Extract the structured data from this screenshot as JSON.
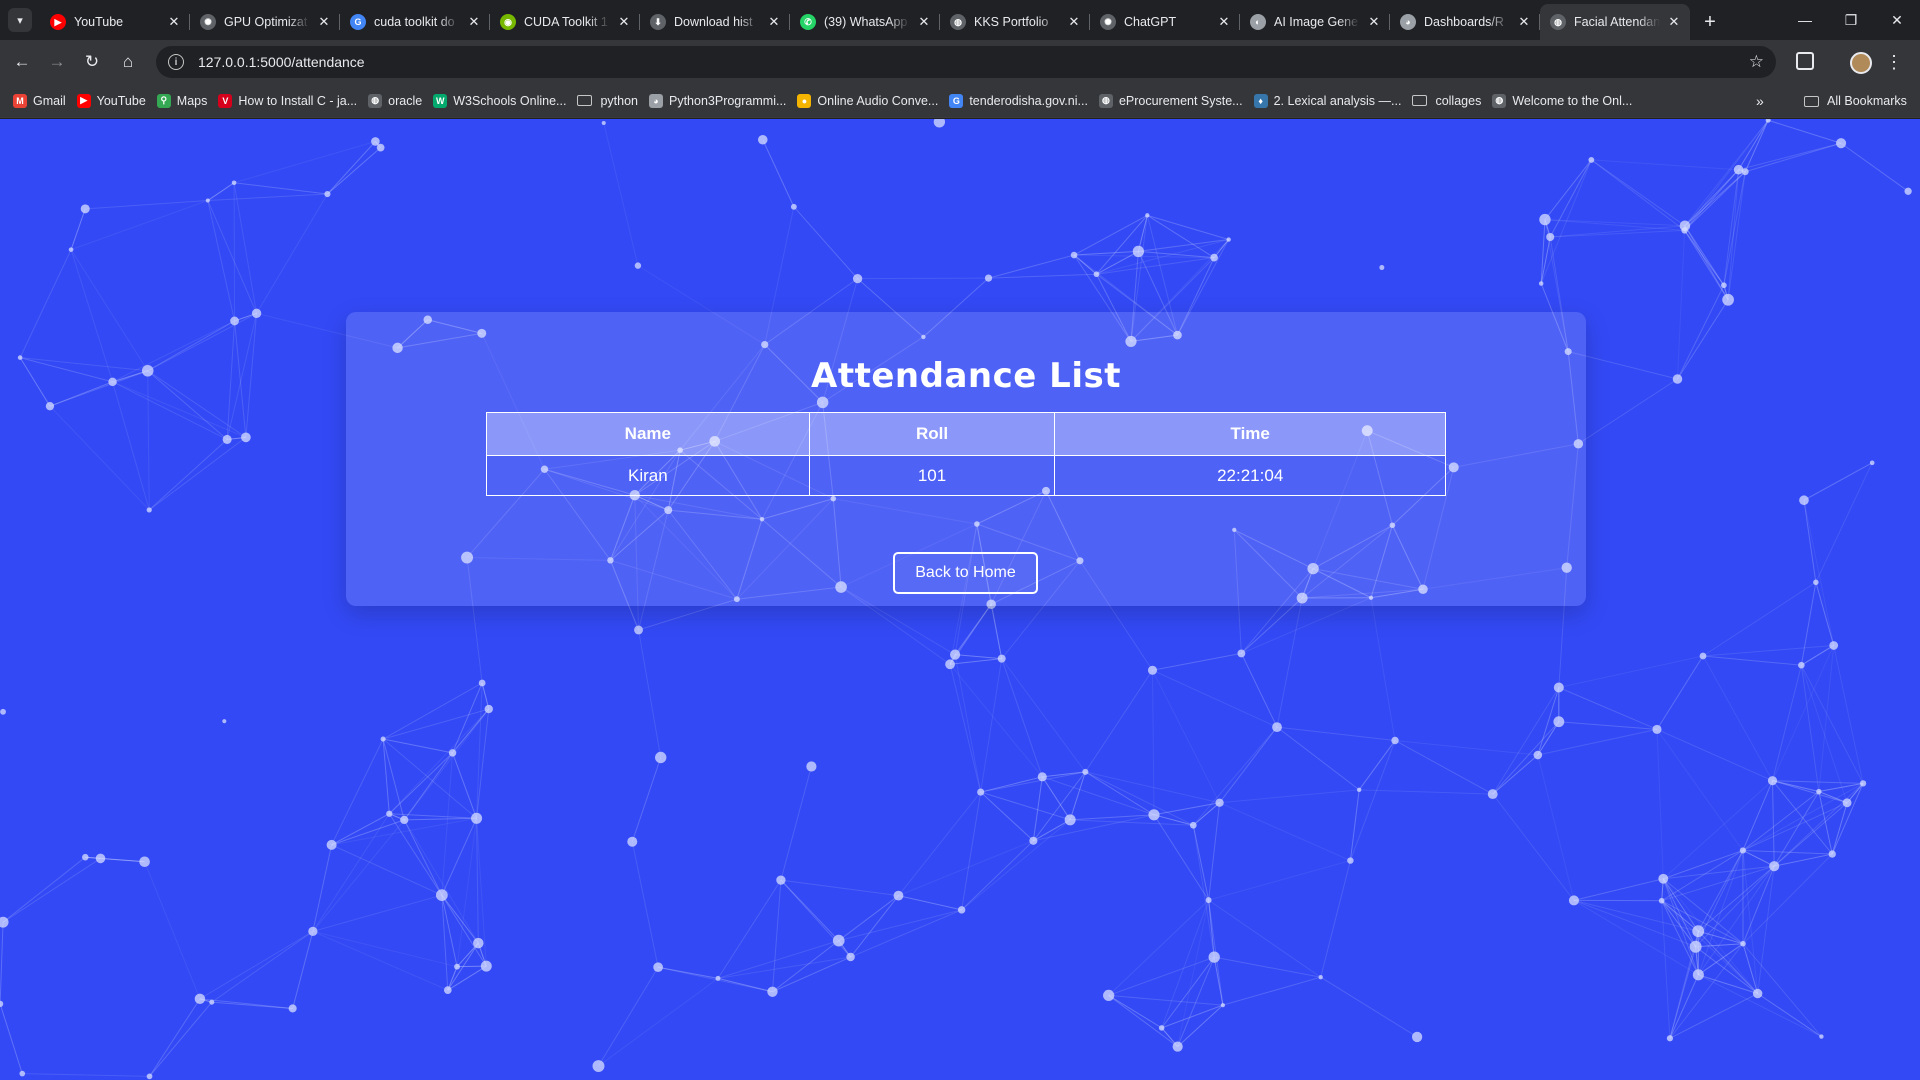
{
  "browser": {
    "tabs": [
      {
        "title": "YouTube",
        "icon": "youtube-icon",
        "color": "#ff0000",
        "glyph": "▶",
        "active": false
      },
      {
        "title": "GPU Optimizat",
        "icon": "openai-icon",
        "color": "#5f6368",
        "glyph": "✺",
        "active": false
      },
      {
        "title": "cuda toolkit do",
        "icon": "google-icon",
        "color": "#4285f4",
        "glyph": "G",
        "active": false
      },
      {
        "title": "CUDA Toolkit 1",
        "icon": "nvidia-icon",
        "color": "#76b900",
        "glyph": "◉",
        "active": false
      },
      {
        "title": "Download hist",
        "icon": "download-icon",
        "color": "#5f6368",
        "glyph": "⬇",
        "active": false
      },
      {
        "title": "(39) WhatsApp",
        "icon": "whatsapp-icon",
        "color": "#25d366",
        "glyph": "✆",
        "active": false
      },
      {
        "title": "KKS Portfolio",
        "icon": "globe-icon",
        "color": "#5f6368",
        "glyph": "◍",
        "active": false
      },
      {
        "title": "ChatGPT",
        "icon": "openai-icon",
        "color": "#5f6368",
        "glyph": "✺",
        "active": false
      },
      {
        "title": "AI Image Gene",
        "icon": "ai-icon",
        "color": "#9aa0a6",
        "glyph": "◐",
        "active": false
      },
      {
        "title": "Dashboards/R",
        "icon": "github-icon",
        "color": "#9aa0a6",
        "glyph": "◕",
        "active": false
      },
      {
        "title": "Facial Attendan",
        "icon": "globe-icon",
        "color": "#5f6368",
        "glyph": "◍",
        "active": true
      }
    ],
    "url": "127.0.0.1:5000/attendance",
    "bookmarks": [
      {
        "label": "Gmail",
        "icon": "gmail-icon",
        "color": "#ea4335",
        "glyph": "M"
      },
      {
        "label": "YouTube",
        "icon": "youtube-icon",
        "color": "#ff0000",
        "glyph": "▶"
      },
      {
        "label": "Maps",
        "icon": "maps-icon",
        "color": "#34a853",
        "glyph": "⚲"
      },
      {
        "label": "How to Install C - ja...",
        "icon": "bookmark-v-icon",
        "color": "#d6001c",
        "glyph": "V"
      },
      {
        "label": "oracle",
        "icon": "globe-icon",
        "color": "#5f6368",
        "glyph": "◍"
      },
      {
        "label": "W3Schools Online...",
        "icon": "w3schools-icon",
        "color": "#04aa6d",
        "glyph": "W"
      },
      {
        "label": "python",
        "icon": "folder-icon",
        "folder": true
      },
      {
        "label": "Python3Programmi...",
        "icon": "github-icon",
        "color": "#9aa0a6",
        "glyph": "◕"
      },
      {
        "label": "Online Audio Conve...",
        "icon": "audio-converter-icon",
        "color": "#f4b400",
        "glyph": "●"
      },
      {
        "label": "tenderodisha.gov.ni...",
        "icon": "google-icon",
        "color": "#4285f4",
        "glyph": "G"
      },
      {
        "label": "eProcurement Syste...",
        "icon": "globe-icon",
        "color": "#5f6368",
        "glyph": "◍"
      },
      {
        "label": "2. Lexical analysis —...",
        "icon": "python-icon",
        "color": "#3776ab",
        "glyph": "♦"
      },
      {
        "label": "collages",
        "icon": "folder-icon",
        "folder": true
      },
      {
        "label": "Welcome to the Onl...",
        "icon": "globe-icon",
        "color": "#5f6368",
        "glyph": "◍"
      }
    ],
    "all_bookmarks_label": "All Bookmarks"
  },
  "page": {
    "title": "Attendance List",
    "table": {
      "headers": [
        "Name",
        "Roll",
        "Time"
      ],
      "rows": [
        [
          "Kiran",
          "101",
          "22:21:04"
        ]
      ]
    },
    "back_button_label": "Back to Home",
    "background_color": "#3349f5"
  }
}
